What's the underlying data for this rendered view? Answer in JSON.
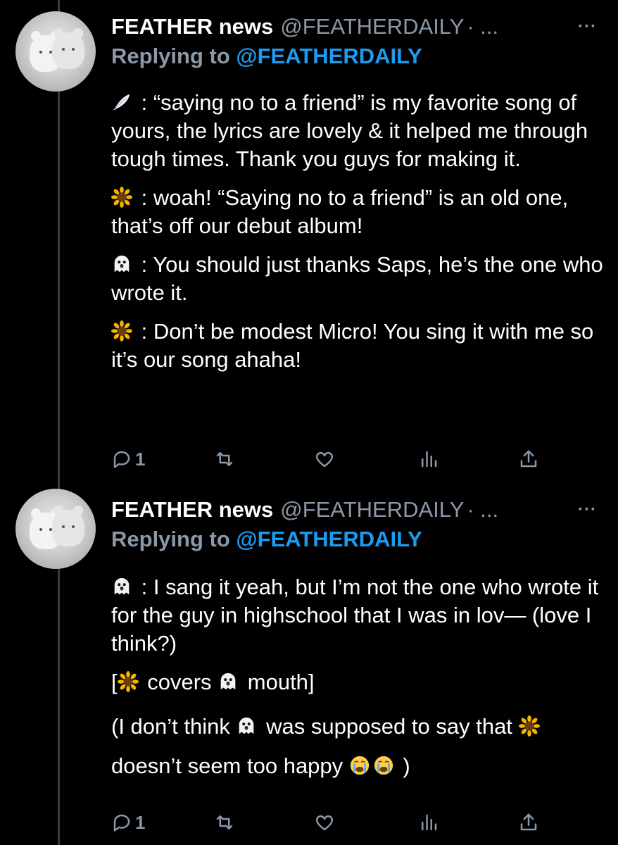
{
  "tweets": [
    {
      "author": {
        "name": "FEATHER news",
        "handle": "@FEATHERDAILY",
        "separator": "· ..."
      },
      "more": "···",
      "reply": {
        "prefix": "Replying to ",
        "mention": "@FEATHERDAILY"
      },
      "paragraphs": [
        {
          "emoji": "feather-icon",
          "text": " : “saying no to a friend” is my favorite song of yours, the lyrics are lovely & it helped me through tough times. Thank you guys for making it."
        },
        {
          "emoji": "sunflower-icon",
          "text": " : woah! “Saying no to a friend” is an old one, that’s off our debut album!"
        },
        {
          "emoji": "ghost-icon",
          "text": " : You should just thanks Saps, he’s the one who wrote it."
        },
        {
          "emoji": "sunflower-icon",
          "text": " : Don’t be modest Micro! You sing it with me so it’s our song ahaha!"
        }
      ],
      "actions": {
        "reply_count": "1"
      }
    },
    {
      "author": {
        "name": "FEATHER news",
        "handle": "@FEATHERDAILY",
        "separator": "· ..."
      },
      "more": "···",
      "reply": {
        "prefix": "Replying to ",
        "mention": "@FEATHERDAILY"
      },
      "p1": " : I sang it yeah, but I’m not the one who wrote it for the guy in highschool that I was in lov— (love I think?)",
      "p2": {
        "open": "[",
        "mid1": " covers ",
        "mid2": " mouth]"
      },
      "p3": {
        "a": "(I don’t think ",
        "b": " was supposed to say that ",
        "c": " doesn’t seem too happy ",
        "d": " )"
      },
      "actions": {
        "reply_count": "1"
      }
    }
  ],
  "colors": {
    "background": "#000000",
    "text": "#ffffff",
    "muted": "#8b98a5",
    "link": "#1d9bf0"
  }
}
